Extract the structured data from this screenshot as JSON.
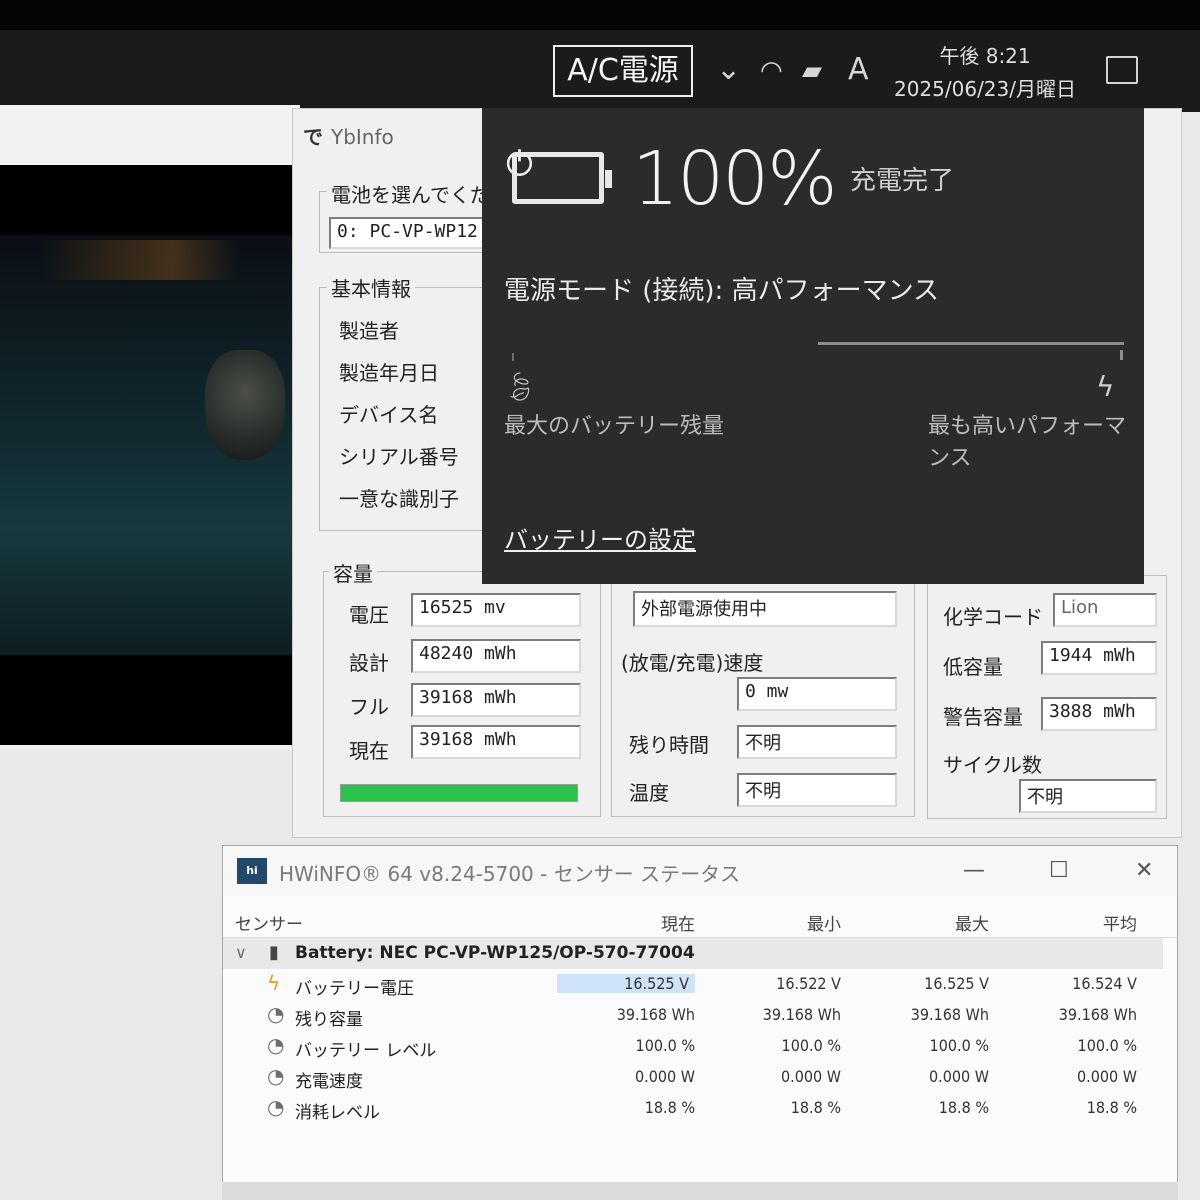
{
  "taskbar": {
    "power_label": "A/C電源",
    "ime": "A",
    "time": "午後 8:21",
    "date": "2025/06/23/月曜日"
  },
  "ybinfo": {
    "title": "YbInfo",
    "battery_select_label": "電池を選んでくだ",
    "battery_select_value": "0: PC-VP-WP12",
    "basic_info_label": "基本情報",
    "basic_fields": [
      "製造者",
      "製造年月日",
      "デバイス名",
      "シリアル番号",
      "一意な識別子"
    ],
    "capacity_label": "容量",
    "voltage_label": "電圧",
    "voltage": "16525 mv",
    "design_label": "設計",
    "design": "48240 mWh",
    "full_label": "フル",
    "full": "39168 mWh",
    "current_label": "現在",
    "current": "39168 mWh",
    "charge_fraction": 1.0,
    "power_state": "外部電源使用中",
    "rate_label": "(放電/充電)速度",
    "rate": "0 mw",
    "remaining_label": "残り時間",
    "remaining": "不明",
    "temp_label": "温度",
    "temp": "不明",
    "chem_label": "化学コード",
    "chem": "Lion",
    "low_label": "低容量",
    "low": "1944 mWh",
    "warn_label": "警告容量",
    "warn": "3888 mWh",
    "cycle_label": "サイクル数",
    "cycle": "不明"
  },
  "flyout": {
    "percent": "100%",
    "status": "充電完了",
    "mode": "電源モード (接続): 高パフォーマンス",
    "left_caption": "最大のバッテリー残量",
    "right_caption": "最も高いパフォーマンス",
    "settings_link": "バッテリーの設定",
    "slider_level": 1.0
  },
  "hwinfo": {
    "title": "HWiNFO® 64 v8.24-5700 - センサー ステータス",
    "columns": [
      "センサー",
      "現在",
      "最小",
      "最大",
      "平均"
    ],
    "group": "Battery: NEC PC-VP-WP125/OP-570-77004",
    "rows": [
      {
        "name": "バッテリー電圧",
        "icon": "lightning-icon",
        "cur": "16.525 V",
        "min": "16.522 V",
        "max": "16.525 V",
        "avg": "16.524 V"
      },
      {
        "name": "残り容量",
        "icon": "clock-icon",
        "cur": "39.168 Wh",
        "min": "39.168 Wh",
        "max": "39.168 Wh",
        "avg": "39.168 Wh"
      },
      {
        "name": "バッテリー レベル",
        "icon": "clock-icon",
        "cur": "100.0 %",
        "min": "100.0 %",
        "max": "100.0 %",
        "avg": "100.0 %"
      },
      {
        "name": "充電速度",
        "icon": "clock-icon",
        "cur": "0.000 W",
        "min": "0.000 W",
        "max": "0.000 W",
        "avg": "0.000 W"
      },
      {
        "name": "消耗レベル",
        "icon": "clock-icon",
        "cur": "18.8 %",
        "min": "18.8 %",
        "max": "18.8 %",
        "avg": "18.8 %"
      }
    ]
  }
}
